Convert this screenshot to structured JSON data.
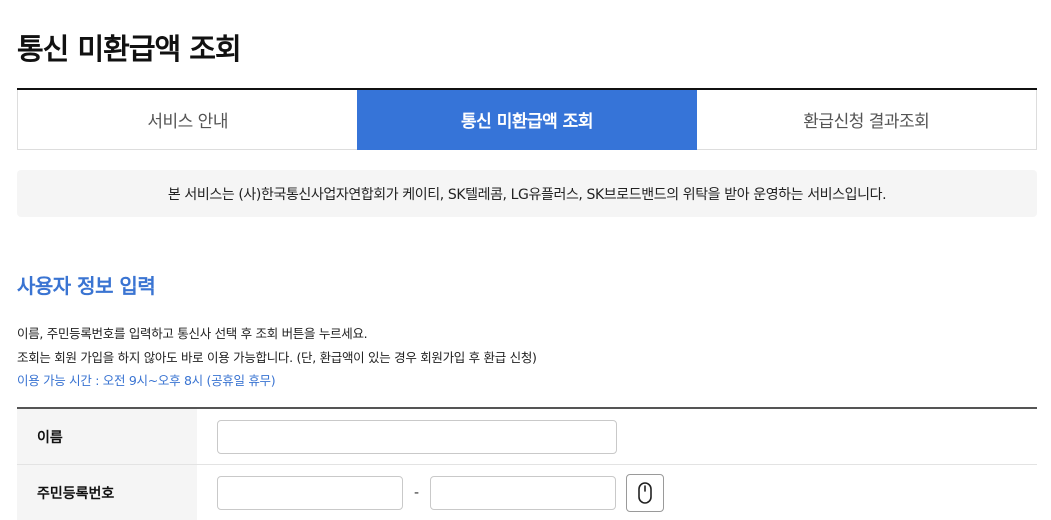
{
  "page": {
    "title": "통신 미환급액 조회"
  },
  "tabs": [
    {
      "label": "서비스 안내",
      "active": false
    },
    {
      "label": "통신 미환급액 조회",
      "active": true
    },
    {
      "label": "환급신청 결과조회",
      "active": false
    }
  ],
  "notice": {
    "text": "본 서비스는 (사)한국통신사업자연합회가 케이티, SK텔레콤, LG유플러스, SK브로드밴드의 위탁을 받아 운영하는 서비스입니다."
  },
  "section": {
    "title": "사용자 정보 입력",
    "desc_line1": "이름, 주민등록번호를 입력하고 통신사 선택 후 조회 버튼을 누르세요.",
    "desc_line2": "조회는 회원 가입을 하지 않아도 바로 이용 가능합니다. (단, 환급액이 있는 경우 회원가입 후 환급 신청)",
    "hours": "이용 가능 시간 : 오전 9시~오후 8시 (공휴일 휴무)"
  },
  "form": {
    "name_label": "이름",
    "name_value": "",
    "rrn_label": "주민등록번호",
    "rrn_front_value": "",
    "rrn_back_value": "",
    "rrn_separator": "-",
    "keypad_icon": "mouse-icon"
  },
  "colors": {
    "accent": "#3674d8",
    "section_title": "#3a74d2"
  }
}
